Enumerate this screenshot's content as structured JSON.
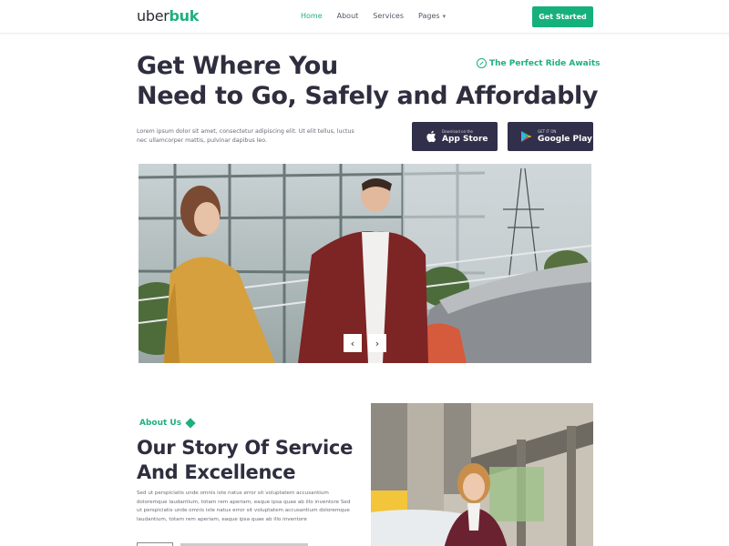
{
  "brand": {
    "name_start": "uber",
    "name_accent": "buk",
    "accent_color": "#1faf7f",
    "dark_color": "#31304a"
  },
  "nav": {
    "items": [
      {
        "label": "Home",
        "active": true
      },
      {
        "label": "About",
        "active": false
      },
      {
        "label": "Services",
        "active": false
      },
      {
        "label": "Pages",
        "active": false,
        "dropdown": true
      }
    ],
    "cta_label": "Get Started"
  },
  "hero": {
    "title_line1": "Get Where You",
    "title_line2": "Need to Go, Safely and Affordably",
    "tagline": "The Perfect Ride Awaits",
    "tagline_icon": "compass-icon",
    "description": "Lorem ipsum dolor sit amet, consectetur adipiscing elit. Ut elit tellus, luctus nec ullamcorper mattis, pulvinar dapibus leo.",
    "app_store": {
      "small": "Download on the",
      "big": "App Store",
      "icon": "apple-icon"
    },
    "google_play": {
      "small": "GET IT ON",
      "big": "Google Play",
      "icon": "google-play-icon"
    },
    "carousel": {
      "prev": "‹",
      "next": "›"
    }
  },
  "about": {
    "label": "About Us",
    "title_line1": "Our Story Of Service",
    "title_line2": "And Excellence",
    "body": "Sed ut perspiciatis unde omnis iste natus error sit voluptatem accusantium doloremque laudantium, totam rem aperiam, eaque ipsa quae ab illo inventore Sed ut perspiciatis unde omnis iste natus error sit voluptatem accusantium doloremque laudantium, totam rem aperiam, eaque ipsa quae ab illo inventore"
  }
}
